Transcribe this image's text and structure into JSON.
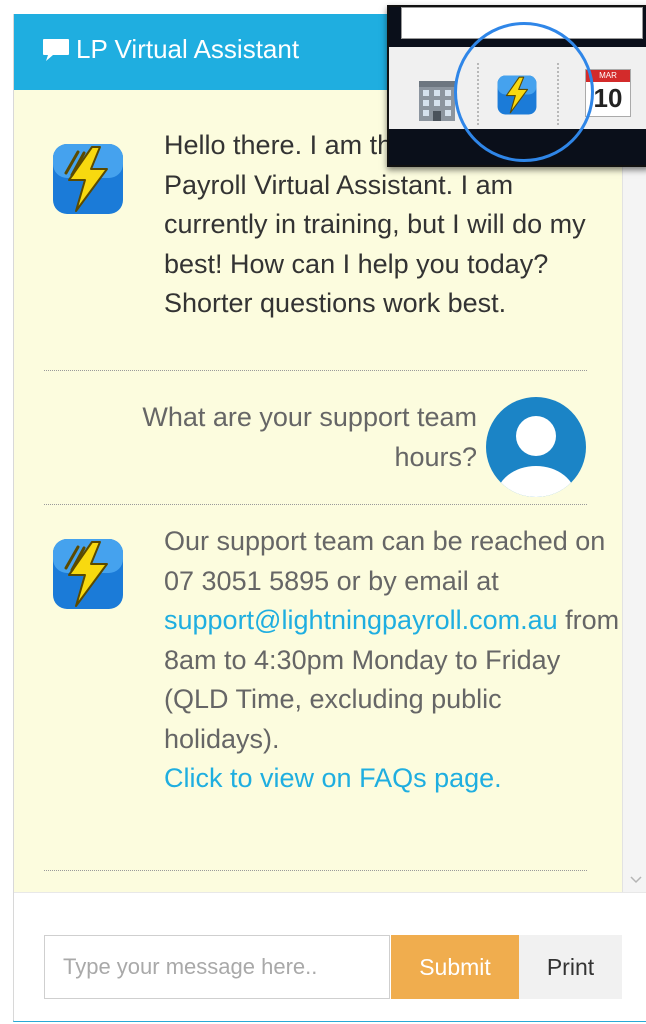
{
  "header": {
    "title": "LP Virtual Assistant",
    "icon": "chat-bubble-icon"
  },
  "messages": [
    {
      "from": "bot",
      "avatar": "lightning-icon",
      "text": "Hello there. I am the Lightning Payroll Virtual Assistant. I am currently in training, but I will do my best! How can I help you today? Shorter questions work best."
    },
    {
      "from": "user",
      "avatar": "user-icon",
      "text": "What are your support team hours?"
    },
    {
      "from": "bot",
      "avatar": "lightning-icon",
      "text_before": "Our support team can be reached on 07 3051 5895 or by email at",
      "email": "support@lightningpayroll.com.au",
      "text_after": "from 8am to 4:30pm Monday to Friday (QLD Time, excluding public holidays).",
      "faq_link": "Click to view on FAQs page."
    }
  ],
  "input": {
    "placeholder": "Type your message here..",
    "value": ""
  },
  "buttons": {
    "submit": "Submit",
    "print": "Print"
  },
  "overlay": {
    "calendar_month": "MAR",
    "calendar_day": "10",
    "icons": [
      "building-icon",
      "lightning-icon",
      "calendar-icon"
    ]
  },
  "colors": {
    "header": "#1faee0",
    "chat_bg": "#fcfcde",
    "submit": "#f0ad4e",
    "link": "#1faee0",
    "highlight_circle": "#2f86e8"
  }
}
